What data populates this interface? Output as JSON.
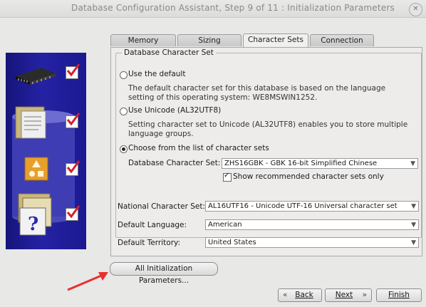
{
  "window": {
    "title": "Database Configuration Assistant, Step 9 of 11 : Initialization Parameters"
  },
  "tabs": [
    "Memory",
    "Sizing",
    "Character Sets",
    "Connection Mode"
  ],
  "active_tab": "Character Sets",
  "charset_group": {
    "legend": "Database Character Set",
    "option_default": {
      "label": "Use the default",
      "description": "The default character set for this database is based on the language setting of this operating system: WE8MSWIN1252."
    },
    "option_unicode": {
      "label": "Use Unicode (AL32UTF8)",
      "description": "Setting character set to Unicode (AL32UTF8) enables you to store multiple language groups."
    },
    "option_list": {
      "label": "Choose from the list of character sets"
    },
    "db_charset": {
      "label": "Database Character Set:",
      "value": "ZHS16GBK - GBK 16-bit Simplified Chinese"
    },
    "show_recommended": {
      "label": "Show recommended character sets only",
      "checked": true
    }
  },
  "national": {
    "label": "National Character Set:",
    "value": "AL16UTF16 - Unicode UTF-16 Universal character set"
  },
  "language": {
    "label": "Default Language:",
    "value": "American"
  },
  "territory": {
    "label": "Default Territory:",
    "value": "United States"
  },
  "buttons": {
    "all_params": "All Initialization Parameters...",
    "back": "Back",
    "next": "Next",
    "finish": "Finish"
  },
  "colors": {
    "sidebar": "#1e1c96",
    "checkmark": "#d2202a",
    "arrow": "#e8322d"
  }
}
